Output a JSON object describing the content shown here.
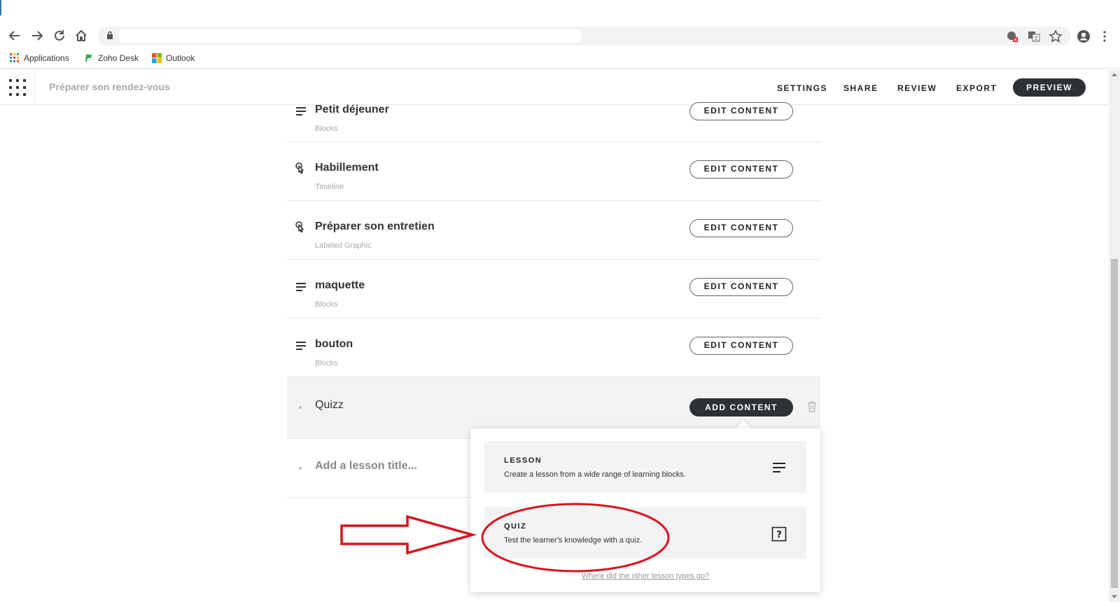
{
  "browser": {
    "bookmarks": [
      {
        "label": "Applications",
        "icon": "apps-grid-icon"
      },
      {
        "label": "Zoho Desk",
        "icon": "zoho-desk-icon"
      },
      {
        "label": "Outlook",
        "icon": "outlook-icon"
      }
    ]
  },
  "header": {
    "course_title": "Préparer son rendez-vous",
    "settings": "SETTINGS",
    "share": "SHARE",
    "review": "REVIEW",
    "export": "EXPORT",
    "preview": "PREVIEW"
  },
  "lessons": [
    {
      "name": "Petit déjeuner",
      "type": "Blocks",
      "icon": "blocks-icon",
      "button": "EDIT CONTENT"
    },
    {
      "name": "Habillement",
      "type": "Timeline",
      "icon": "interactive-icon",
      "button": "EDIT CONTENT"
    },
    {
      "name": "Préparer son entretien",
      "type": "Labeled Graphic",
      "icon": "interactive-icon",
      "button": "EDIT CONTENT"
    },
    {
      "name": "maquette",
      "type": "Blocks",
      "icon": "blocks-icon",
      "button": "EDIT CONTENT"
    },
    {
      "name": "bouton",
      "type": "Blocks",
      "icon": "blocks-icon",
      "button": "EDIT CONTENT"
    }
  ],
  "new_lesson": {
    "name": "Quizz",
    "add_button": "ADD CONTENT",
    "trash_icon": "trash-icon"
  },
  "add_lesson": {
    "placeholder": "Add a lesson title..."
  },
  "popover": {
    "lesson": {
      "title": "LESSON",
      "desc": "Create a lesson from a wide range of learning blocks.",
      "icon": "blocks-icon"
    },
    "quiz": {
      "title": "QUIZ",
      "desc": "Test the learner's knowledge with a quiz.",
      "icon": "question-box-icon"
    },
    "other_link": "Where did the other lesson types go?"
  },
  "colors": {
    "dark_button": "#2d3035",
    "annotation_red": "#d9131e"
  }
}
